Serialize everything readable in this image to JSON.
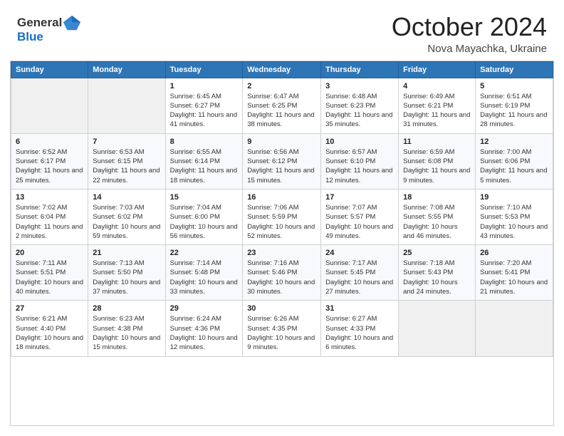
{
  "header": {
    "month_title": "October 2024",
    "subtitle": "Nova Mayachka, Ukraine",
    "logo_general": "General",
    "logo_blue": "Blue"
  },
  "days_of_week": [
    "Sunday",
    "Monday",
    "Tuesday",
    "Wednesday",
    "Thursday",
    "Friday",
    "Saturday"
  ],
  "weeks": [
    [
      {
        "day": "",
        "sunrise": "",
        "sunset": "",
        "daylight": "",
        "empty": true
      },
      {
        "day": "",
        "sunrise": "",
        "sunset": "",
        "daylight": "",
        "empty": true
      },
      {
        "day": "1",
        "sunrise": "Sunrise: 6:45 AM",
        "sunset": "Sunset: 6:27 PM",
        "daylight": "Daylight: 11 hours and 41 minutes.",
        "empty": false
      },
      {
        "day": "2",
        "sunrise": "Sunrise: 6:47 AM",
        "sunset": "Sunset: 6:25 PM",
        "daylight": "Daylight: 11 hours and 38 minutes.",
        "empty": false
      },
      {
        "day": "3",
        "sunrise": "Sunrise: 6:48 AM",
        "sunset": "Sunset: 6:23 PM",
        "daylight": "Daylight: 11 hours and 35 minutes.",
        "empty": false
      },
      {
        "day": "4",
        "sunrise": "Sunrise: 6:49 AM",
        "sunset": "Sunset: 6:21 PM",
        "daylight": "Daylight: 11 hours and 31 minutes.",
        "empty": false
      },
      {
        "day": "5",
        "sunrise": "Sunrise: 6:51 AM",
        "sunset": "Sunset: 6:19 PM",
        "daylight": "Daylight: 11 hours and 28 minutes.",
        "empty": false
      }
    ],
    [
      {
        "day": "6",
        "sunrise": "Sunrise: 6:52 AM",
        "sunset": "Sunset: 6:17 PM",
        "daylight": "Daylight: 11 hours and 25 minutes.",
        "empty": false
      },
      {
        "day": "7",
        "sunrise": "Sunrise: 6:53 AM",
        "sunset": "Sunset: 6:15 PM",
        "daylight": "Daylight: 11 hours and 22 minutes.",
        "empty": false
      },
      {
        "day": "8",
        "sunrise": "Sunrise: 6:55 AM",
        "sunset": "Sunset: 6:14 PM",
        "daylight": "Daylight: 11 hours and 18 minutes.",
        "empty": false
      },
      {
        "day": "9",
        "sunrise": "Sunrise: 6:56 AM",
        "sunset": "Sunset: 6:12 PM",
        "daylight": "Daylight: 11 hours and 15 minutes.",
        "empty": false
      },
      {
        "day": "10",
        "sunrise": "Sunrise: 6:57 AM",
        "sunset": "Sunset: 6:10 PM",
        "daylight": "Daylight: 11 hours and 12 minutes.",
        "empty": false
      },
      {
        "day": "11",
        "sunrise": "Sunrise: 6:59 AM",
        "sunset": "Sunset: 6:08 PM",
        "daylight": "Daylight: 11 hours and 9 minutes.",
        "empty": false
      },
      {
        "day": "12",
        "sunrise": "Sunrise: 7:00 AM",
        "sunset": "Sunset: 6:06 PM",
        "daylight": "Daylight: 11 hours and 5 minutes.",
        "empty": false
      }
    ],
    [
      {
        "day": "13",
        "sunrise": "Sunrise: 7:02 AM",
        "sunset": "Sunset: 6:04 PM",
        "daylight": "Daylight: 11 hours and 2 minutes.",
        "empty": false
      },
      {
        "day": "14",
        "sunrise": "Sunrise: 7:03 AM",
        "sunset": "Sunset: 6:02 PM",
        "daylight": "Daylight: 10 hours and 59 minutes.",
        "empty": false
      },
      {
        "day": "15",
        "sunrise": "Sunrise: 7:04 AM",
        "sunset": "Sunset: 6:00 PM",
        "daylight": "Daylight: 10 hours and 56 minutes.",
        "empty": false
      },
      {
        "day": "16",
        "sunrise": "Sunrise: 7:06 AM",
        "sunset": "Sunset: 5:59 PM",
        "daylight": "Daylight: 10 hours and 52 minutes.",
        "empty": false
      },
      {
        "day": "17",
        "sunrise": "Sunrise: 7:07 AM",
        "sunset": "Sunset: 5:57 PM",
        "daylight": "Daylight: 10 hours and 49 minutes.",
        "empty": false
      },
      {
        "day": "18",
        "sunrise": "Sunrise: 7:08 AM",
        "sunset": "Sunset: 5:55 PM",
        "daylight": "Daylight: 10 hours and 46 minutes.",
        "empty": false
      },
      {
        "day": "19",
        "sunrise": "Sunrise: 7:10 AM",
        "sunset": "Sunset: 5:53 PM",
        "daylight": "Daylight: 10 hours and 43 minutes.",
        "empty": false
      }
    ],
    [
      {
        "day": "20",
        "sunrise": "Sunrise: 7:11 AM",
        "sunset": "Sunset: 5:51 PM",
        "daylight": "Daylight: 10 hours and 40 minutes.",
        "empty": false
      },
      {
        "day": "21",
        "sunrise": "Sunrise: 7:13 AM",
        "sunset": "Sunset: 5:50 PM",
        "daylight": "Daylight: 10 hours and 37 minutes.",
        "empty": false
      },
      {
        "day": "22",
        "sunrise": "Sunrise: 7:14 AM",
        "sunset": "Sunset: 5:48 PM",
        "daylight": "Daylight: 10 hours and 33 minutes.",
        "empty": false
      },
      {
        "day": "23",
        "sunrise": "Sunrise: 7:16 AM",
        "sunset": "Sunset: 5:46 PM",
        "daylight": "Daylight: 10 hours and 30 minutes.",
        "empty": false
      },
      {
        "day": "24",
        "sunrise": "Sunrise: 7:17 AM",
        "sunset": "Sunset: 5:45 PM",
        "daylight": "Daylight: 10 hours and 27 minutes.",
        "empty": false
      },
      {
        "day": "25",
        "sunrise": "Sunrise: 7:18 AM",
        "sunset": "Sunset: 5:43 PM",
        "daylight": "Daylight: 10 hours and 24 minutes.",
        "empty": false
      },
      {
        "day": "26",
        "sunrise": "Sunrise: 7:20 AM",
        "sunset": "Sunset: 5:41 PM",
        "daylight": "Daylight: 10 hours and 21 minutes.",
        "empty": false
      }
    ],
    [
      {
        "day": "27",
        "sunrise": "Sunrise: 6:21 AM",
        "sunset": "Sunset: 4:40 PM",
        "daylight": "Daylight: 10 hours and 18 minutes.",
        "empty": false
      },
      {
        "day": "28",
        "sunrise": "Sunrise: 6:23 AM",
        "sunset": "Sunset: 4:38 PM",
        "daylight": "Daylight: 10 hours and 15 minutes.",
        "empty": false
      },
      {
        "day": "29",
        "sunrise": "Sunrise: 6:24 AM",
        "sunset": "Sunset: 4:36 PM",
        "daylight": "Daylight: 10 hours and 12 minutes.",
        "empty": false
      },
      {
        "day": "30",
        "sunrise": "Sunrise: 6:26 AM",
        "sunset": "Sunset: 4:35 PM",
        "daylight": "Daylight: 10 hours and 9 minutes.",
        "empty": false
      },
      {
        "day": "31",
        "sunrise": "Sunrise: 6:27 AM",
        "sunset": "Sunset: 4:33 PM",
        "daylight": "Daylight: 10 hours and 6 minutes.",
        "empty": false
      },
      {
        "day": "",
        "sunrise": "",
        "sunset": "",
        "daylight": "",
        "empty": true
      },
      {
        "day": "",
        "sunrise": "",
        "sunset": "",
        "daylight": "",
        "empty": true
      }
    ]
  ]
}
